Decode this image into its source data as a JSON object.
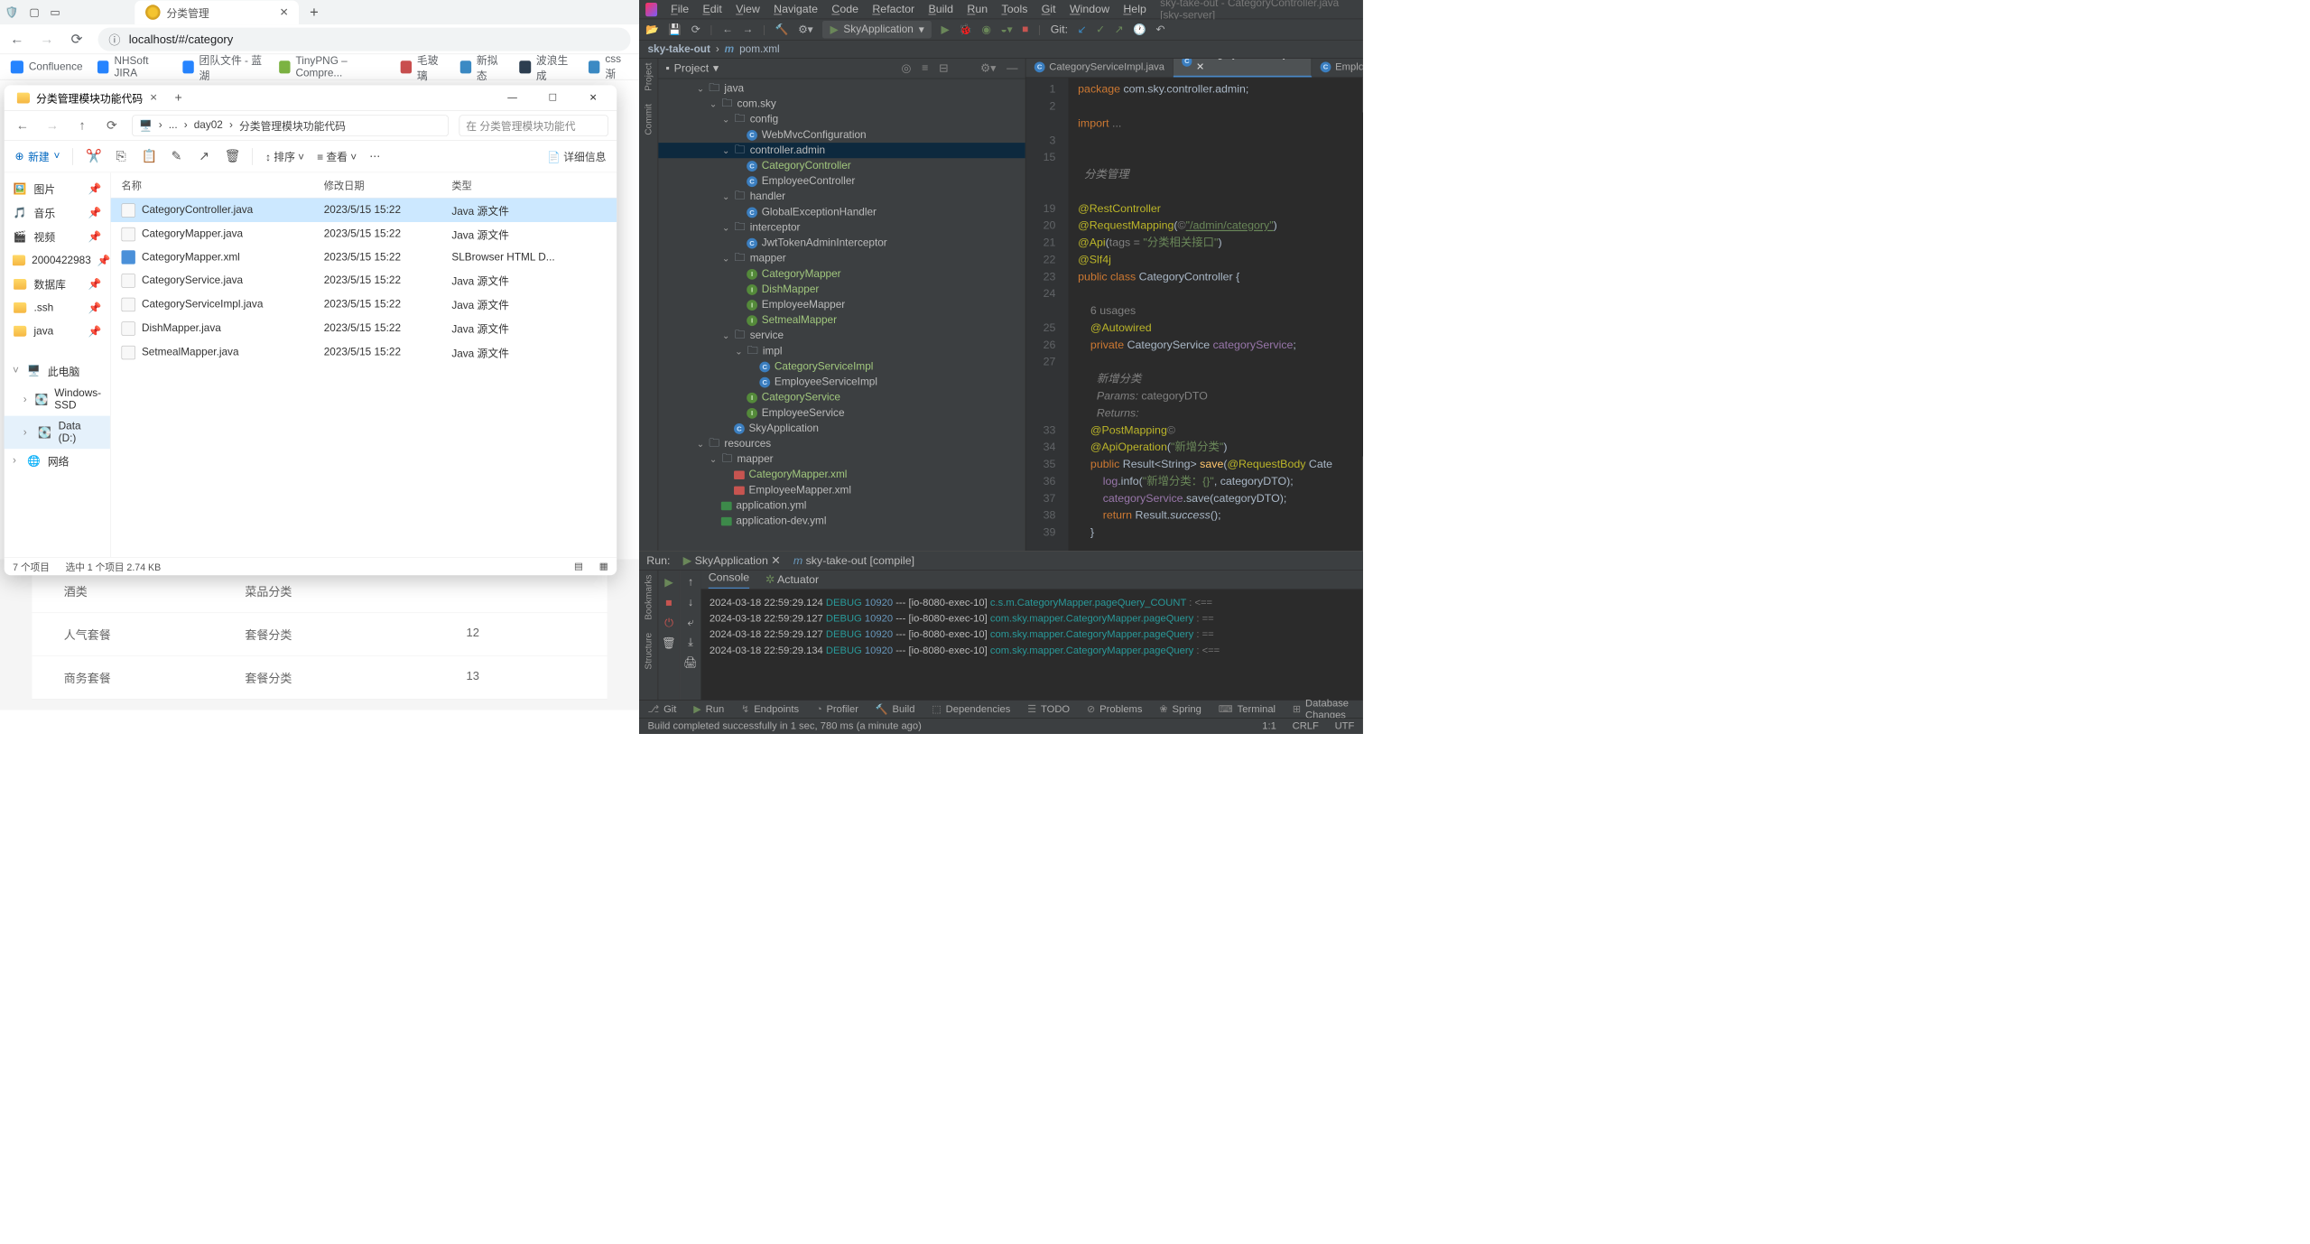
{
  "browser": {
    "tab": {
      "title": "分类管理"
    },
    "url": "localhost/#/category",
    "bookmarks": [
      "Confluence",
      "NHSoft JIRA",
      "团队文件 - 蓝湖",
      "TinyPNG – Compre...",
      "毛玻璃",
      "新拟态",
      "波浪生成",
      "css渐"
    ]
  },
  "page_rows": [
    {
      "a": "酒类",
      "b": "菜品分类",
      "c": ""
    },
    {
      "a": "人气套餐",
      "b": "套餐分类",
      "c": "12"
    },
    {
      "a": "商务套餐",
      "b": "套餐分类",
      "c": "13"
    }
  ],
  "explorer": {
    "title": "分类管理模块功能代码",
    "path": [
      "...",
      "day02",
      "分类管理模块功能代码"
    ],
    "search_ph": "在 分类管理模块功能代",
    "new_label": "新建",
    "sort_label": "排序",
    "view_label": "查看",
    "detail_label": "详细信息",
    "side": [
      {
        "icon": "pic",
        "label": "图片"
      },
      {
        "icon": "music",
        "label": "音乐"
      },
      {
        "icon": "video",
        "label": "视频"
      },
      {
        "icon": "folder",
        "label": "2000422983"
      },
      {
        "icon": "folder",
        "label": "数据库"
      },
      {
        "icon": "folder",
        "label": ".ssh"
      },
      {
        "icon": "folder",
        "label": "java"
      }
    ],
    "side2": [
      {
        "icon": "pc",
        "label": "此电脑",
        "chev": "v"
      },
      {
        "icon": "drive",
        "label": "Windows-SSD",
        "indent": 1
      },
      {
        "icon": "drive",
        "label": "Data (D:)",
        "indent": 1,
        "sel": true
      },
      {
        "icon": "net",
        "label": "网络"
      }
    ],
    "columns": [
      "名称",
      "修改日期",
      "类型"
    ],
    "files": [
      {
        "name": "CategoryController.java",
        "date": "2023/5/15 15:22",
        "type": "Java 源文件",
        "selected": true
      },
      {
        "name": "CategoryMapper.java",
        "date": "2023/5/15 15:22",
        "type": "Java 源文件"
      },
      {
        "name": "CategoryMapper.xml",
        "date": "2023/5/15 15:22",
        "type": "SLBrowser HTML D...",
        "xml": true
      },
      {
        "name": "CategoryService.java",
        "date": "2023/5/15 15:22",
        "type": "Java 源文件"
      },
      {
        "name": "CategoryServiceImpl.java",
        "date": "2023/5/15 15:22",
        "type": "Java 源文件"
      },
      {
        "name": "DishMapper.java",
        "date": "2023/5/15 15:22",
        "type": "Java 源文件"
      },
      {
        "name": "SetmealMapper.java",
        "date": "2023/5/15 15:22",
        "type": "Java 源文件"
      }
    ],
    "status": [
      "7 个项目",
      "选中 1 个项目 2.74 KB"
    ]
  },
  "ide": {
    "menu": [
      "File",
      "Edit",
      "View",
      "Navigate",
      "Code",
      "Refactor",
      "Build",
      "Run",
      "Tools",
      "Git",
      "Window",
      "Help"
    ],
    "win_title": "sky-take-out - CategoryController.java [sky-server]",
    "run_config": "SkyApplication",
    "git_label": "Git:",
    "breadcrumb": [
      "sky-take-out",
      "pom.xml"
    ],
    "project_label": "Project",
    "tree": [
      {
        "d": 3,
        "a": "v",
        "i": "folder",
        "t": "java"
      },
      {
        "d": 4,
        "a": "v",
        "i": "folder",
        "t": "com.sky"
      },
      {
        "d": 5,
        "a": "v",
        "i": "folder",
        "t": "config"
      },
      {
        "d": 6,
        "a": "",
        "i": "class",
        "t": "WebMvcConfiguration"
      },
      {
        "d": 5,
        "a": "v",
        "i": "folder",
        "t": "controller.admin",
        "sel": true
      },
      {
        "d": 6,
        "a": "",
        "i": "class",
        "t": "CategoryController",
        "g": true
      },
      {
        "d": 6,
        "a": "",
        "i": "class",
        "t": "EmployeeController"
      },
      {
        "d": 5,
        "a": "v",
        "i": "folder",
        "t": "handler"
      },
      {
        "d": 6,
        "a": "",
        "i": "class",
        "t": "GlobalExceptionHandler"
      },
      {
        "d": 5,
        "a": "v",
        "i": "folder",
        "t": "interceptor"
      },
      {
        "d": 6,
        "a": "",
        "i": "class",
        "t": "JwtTokenAdminInterceptor"
      },
      {
        "d": 5,
        "a": "v",
        "i": "folder",
        "t": "mapper"
      },
      {
        "d": 6,
        "a": "",
        "i": "iface",
        "t": "CategoryMapper",
        "g": true
      },
      {
        "d": 6,
        "a": "",
        "i": "iface",
        "t": "DishMapper",
        "g": true
      },
      {
        "d": 6,
        "a": "",
        "i": "iface",
        "t": "EmployeeMapper"
      },
      {
        "d": 6,
        "a": "",
        "i": "iface",
        "t": "SetmealMapper",
        "g": true
      },
      {
        "d": 5,
        "a": "v",
        "i": "folder",
        "t": "service"
      },
      {
        "d": 6,
        "a": "v",
        "i": "folder",
        "t": "impl"
      },
      {
        "d": 7,
        "a": "",
        "i": "class",
        "t": "CategoryServiceImpl",
        "g": true
      },
      {
        "d": 7,
        "a": "",
        "i": "class",
        "t": "EmployeeServiceImpl"
      },
      {
        "d": 6,
        "a": "",
        "i": "iface",
        "t": "CategoryService",
        "g": true
      },
      {
        "d": 6,
        "a": "",
        "i": "iface",
        "t": "EmployeeService"
      },
      {
        "d": 5,
        "a": "",
        "i": "class",
        "t": "SkyApplication"
      },
      {
        "d": 3,
        "a": "v",
        "i": "folder",
        "t": "resources"
      },
      {
        "d": 4,
        "a": "v",
        "i": "folder",
        "t": "mapper"
      },
      {
        "d": 5,
        "a": "",
        "i": "xml",
        "t": "CategoryMapper.xml",
        "g": true
      },
      {
        "d": 5,
        "a": "",
        "i": "xml",
        "t": "EmployeeMapper.xml"
      },
      {
        "d": 4,
        "a": "",
        "i": "yml",
        "t": "application.yml"
      },
      {
        "d": 4,
        "a": "",
        "i": "yml",
        "t": "application-dev.yml"
      }
    ],
    "editor_tabs": [
      {
        "label": "CategoryServiceImpl.java"
      },
      {
        "label": "CategoryController.java",
        "active": true
      },
      {
        "label": "Employee"
      }
    ],
    "gutter": [
      "1",
      "2",
      "",
      "3",
      "15",
      "",
      "",
      "19",
      "20",
      "21",
      "22",
      "23",
      "24",
      "",
      "25",
      "26",
      "27",
      "",
      "",
      "",
      "33",
      "34",
      "35",
      "36",
      "37",
      "38",
      "39"
    ],
    "code": {
      "pkg": "package com.sky.controller.admin;",
      "imp": "import ...",
      "cm1": "分类管理",
      "a1": "@RestController",
      "a2_pre": "@RequestMapping(",
      "a2_s": "\"/admin/category\"",
      "a2_post": ")",
      "a3_pre": "@Api(tags = ",
      "a3_s": "\"分类相关接口\"",
      "a3_post": ")",
      "a4": "@Slf4j",
      "cls": "public class CategoryController {",
      "usages": "6 usages",
      "aw": "@Autowired",
      "field": "private CategoryService categoryService;",
      "doc1": "新增分类",
      "doc2": "Params: categoryDTO",
      "doc3": "Returns:",
      "pm": "@PostMapping",
      "ao_pre": "@ApiOperation(",
      "ao_s": "\"新增分类\"",
      "ao_post": ")",
      "save_sig": "public Result<String> save(@RequestBody Cate",
      "log_pre": "log.info(",
      "log_s": "\"新增分类：{}\"",
      "log_post": ", categoryDTO);",
      "svc": "categoryService.save(categoryDTO);",
      "ret": "return Result.success();",
      "brace": "}"
    },
    "run_label": "Run:",
    "run_tab1": "SkyApplication",
    "run_tab2": "sky-take-out [compile]",
    "console_label": "Console",
    "actuator_label": "Actuator",
    "log": [
      {
        "time": "2024-03-18 22:59:29.124",
        "lvl": "DEBUG",
        "pid": "10920",
        "thr": "[io-8080-exec-10]",
        "msg": "c.s.m.CategoryMapper.pageQuery_COUNT",
        "tail": ": <=="
      },
      {
        "time": "2024-03-18 22:59:29.127",
        "lvl": "DEBUG",
        "pid": "10920",
        "thr": "[io-8080-exec-10]",
        "msg": "com.sky.mapper.CategoryMapper.pageQuery",
        "tail": ": =="
      },
      {
        "time": "2024-03-18 22:59:29.127",
        "lvl": "DEBUG",
        "pid": "10920",
        "thr": "[io-8080-exec-10]",
        "msg": "com.sky.mapper.CategoryMapper.pageQuery",
        "tail": ": =="
      },
      {
        "time": "2024-03-18 22:59:29.134",
        "lvl": "DEBUG",
        "pid": "10920",
        "thr": "[io-8080-exec-10]",
        "msg": "com.sky.mapper.CategoryMapper.pageQuery",
        "tail": ": <=="
      }
    ],
    "bottom": [
      "Git",
      "Run",
      "Endpoints",
      "Profiler",
      "Build",
      "Dependencies",
      "TODO",
      "Problems",
      "Spring",
      "Terminal",
      "Database Changes"
    ],
    "status_msg": "Build completed successfully in 1 sec, 780 ms (a minute ago)",
    "status_right": [
      "1:1",
      "CRLF",
      "UTF"
    ]
  }
}
